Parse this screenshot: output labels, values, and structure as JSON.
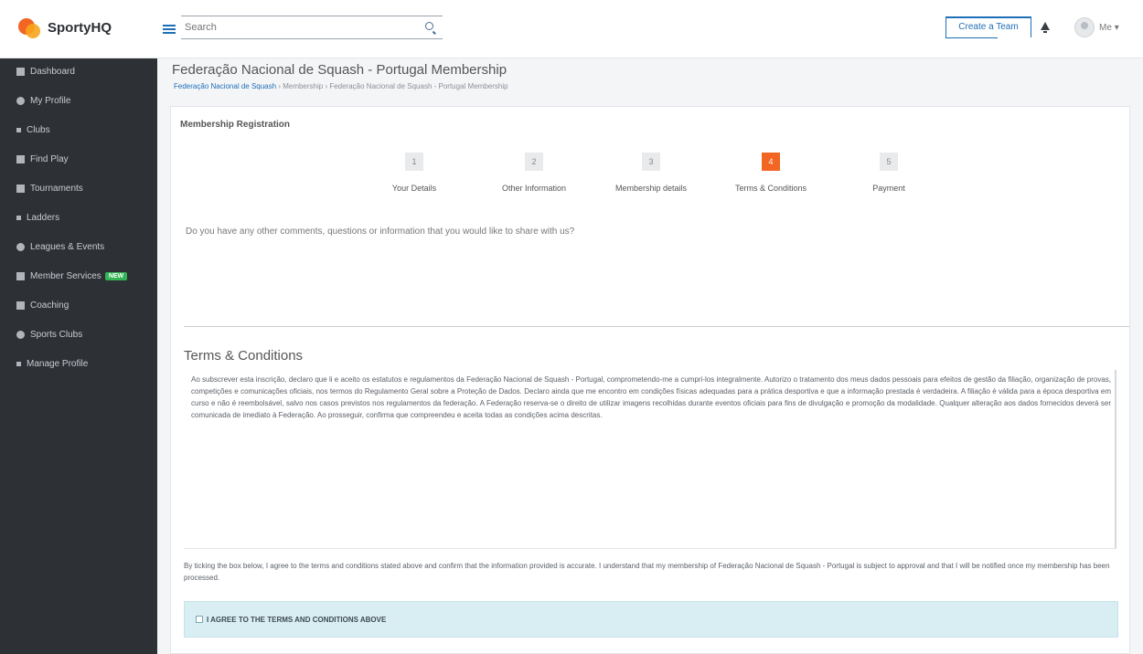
{
  "app": {
    "name": "SportyHQ"
  },
  "header": {
    "search_placeholder": "Search",
    "create_label": "Create a Team",
    "user_label": "Me"
  },
  "sidebar": {
    "items": [
      {
        "label": "Dashboard"
      },
      {
        "label": "My Profile"
      },
      {
        "label": "Clubs"
      },
      {
        "label": "Find Play"
      },
      {
        "label": "Tournaments"
      },
      {
        "label": "Ladders"
      },
      {
        "label": "Leagues & Events"
      },
      {
        "label": "Member Services",
        "badge": "NEW"
      },
      {
        "label": "Coaching"
      },
      {
        "label": "Sports Clubs"
      },
      {
        "label": "Manage Profile"
      }
    ]
  },
  "page": {
    "title": "Federação Nacional de Squash - Portugal Membership",
    "breadcrumb_link": "Federação Nacional de Squash",
    "breadcrumb_rest": "› Membership › Federação Nacional de Squash - Portugal Membership"
  },
  "panel": {
    "header": "Membership Registration",
    "steps": [
      {
        "num": "1",
        "label": "Your Details"
      },
      {
        "num": "2",
        "label": "Other Information"
      },
      {
        "num": "3",
        "label": "Membership details"
      },
      {
        "num": "4",
        "label": "Terms & Conditions"
      },
      {
        "num": "5",
        "label": "Payment"
      }
    ],
    "question": "Do you have any other comments, questions or information that you would like to share with us?",
    "terms_title": "Terms & Conditions",
    "terms_text": "Ao subscrever esta inscrição, declaro que li e aceito os estatutos e regulamentos da Federação Nacional de Squash - Portugal, comprometendo-me a cumpri-los integralmente. Autorizo o tratamento dos meus dados pessoais para efeitos de gestão da filiação, organização de provas, competições e comunicações oficiais, nos termos do Regulamento Geral sobre a Proteção de Dados. Declaro ainda que me encontro em condições físicas adequadas para a prática desportiva e que a informação prestada é verdadeira. A filiação é válida para a época desportiva em curso e não é reembolsável, salvo nos casos previstos nos regulamentos da federação. A Federação reserva-se o direito de utilizar imagens recolhidas durante eventos oficiais para fins de divulgação e promoção da modalidade. Qualquer alteração aos dados fornecidos deverá ser comunicada de imediato à Federação. Ao prosseguir, confirma que compreendeu e aceita todas as condições acima descritas.",
    "agree_text": "By ticking the box below, I agree to the terms and conditions stated above and confirm that the information provided is accurate. I understand that my membership of Federação Nacional de Squash - Portugal is subject to approval and that I will be notified once my membership has been processed.",
    "agree_label": "I AGREE TO THE TERMS AND CONDITIONS ABOVE"
  }
}
